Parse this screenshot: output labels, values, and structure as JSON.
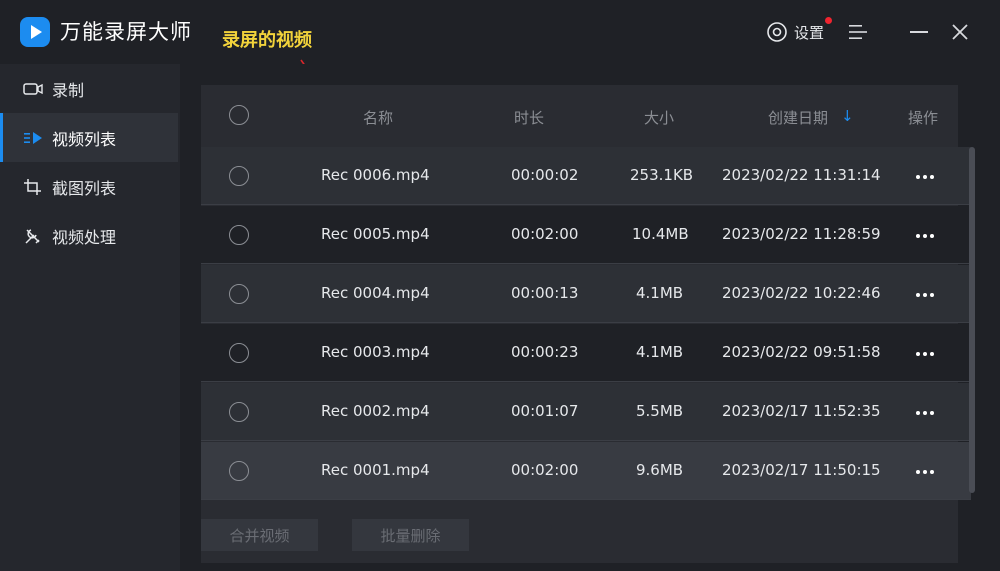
{
  "app": {
    "title": "万能录屏大师",
    "annotation": "录屏的视频",
    "settings_label": "设置"
  },
  "sidebar": {
    "items": [
      {
        "label": "录制",
        "icon": "camera-icon",
        "active": false
      },
      {
        "label": "视频列表",
        "icon": "video-list-icon",
        "active": true
      },
      {
        "label": "截图列表",
        "icon": "screenshot-icon",
        "active": false
      },
      {
        "label": "视频处理",
        "icon": "tools-icon",
        "active": false
      }
    ]
  },
  "table": {
    "headers": {
      "name": "名称",
      "duration": "时长",
      "size": "大小",
      "created": "创建日期",
      "actions": "操作"
    },
    "sort_indicator": "↓",
    "rows": [
      {
        "name": "Rec 0006.mp4",
        "duration": "00:00:02",
        "size": "253.1KB",
        "created": "2023/02/22 11:31:14"
      },
      {
        "name": "Rec 0005.mp4",
        "duration": "00:02:00",
        "size": "10.4MB",
        "created": "2023/02/22 11:28:59"
      },
      {
        "name": "Rec 0004.mp4",
        "duration": "00:00:13",
        "size": "4.1MB",
        "created": "2023/02/22 10:22:46"
      },
      {
        "name": "Rec 0003.mp4",
        "duration": "00:00:23",
        "size": "4.1MB",
        "created": "2023/02/22 09:51:58"
      },
      {
        "name": "Rec 0002.mp4",
        "duration": "00:01:07",
        "size": "5.5MB",
        "created": "2023/02/17 11:52:35"
      },
      {
        "name": "Rec 0001.mp4",
        "duration": "00:02:00",
        "size": "9.6MB",
        "created": "2023/02/17 11:50:15"
      }
    ]
  },
  "footer": {
    "merge_label": "合并视频",
    "batch_delete_label": "批量删除"
  },
  "colors": {
    "accent": "#1c8cf0",
    "annotation": "#f2d33b",
    "notification_dot": "#f0242f"
  }
}
